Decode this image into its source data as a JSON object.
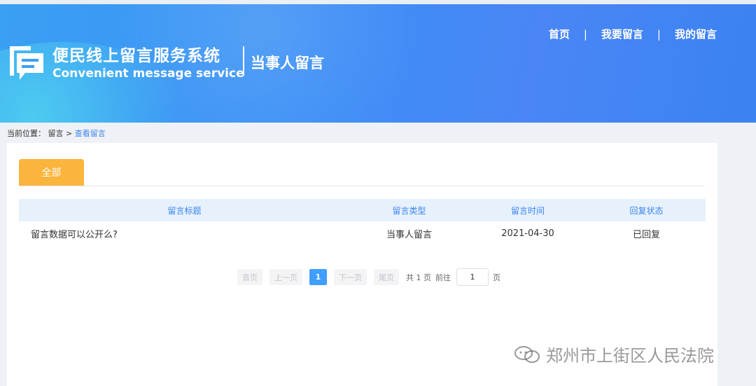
{
  "header": {
    "brand_cn": "便民线上留言服务系统",
    "brand_en": "Convenient message service",
    "subtitle": "当事人留言",
    "nav": [
      "首页",
      "我要留言",
      "我的留言"
    ],
    "nav_sep": "|"
  },
  "breadcrumb": {
    "prefix": "当前位置：",
    "item1": "留言",
    "sep": ">",
    "current": "查看留言"
  },
  "tabs": {
    "all": "全部"
  },
  "table": {
    "headers": [
      "留言标题",
      "留言类型",
      "留言时间",
      "回复状态"
    ],
    "rows": [
      {
        "title": "留言数据可以公开么?",
        "type": "当事人留言",
        "time": "2021-04-30",
        "status": "已回复"
      }
    ]
  },
  "pager": {
    "first": "首页",
    "prev": "上一页",
    "current": "1",
    "next": "下一页",
    "last": "尾页",
    "total": "共 1 页",
    "goto": "前往",
    "goto_value": "1",
    "page_unit": "页"
  },
  "watermark": "郑州市上街区人民法院",
  "colors": {
    "accent": "#3d85f0",
    "tab": "#fbb53c",
    "header": "#3d8ef6"
  }
}
